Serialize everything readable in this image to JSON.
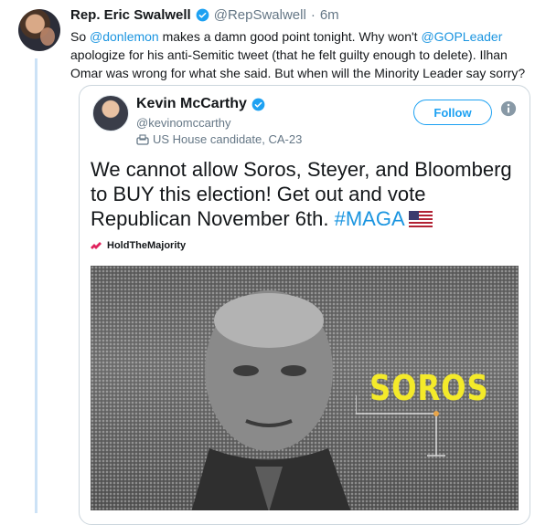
{
  "tweet": {
    "author_name": "Rep. Eric Swalwell",
    "author_handle": "@RepSwalwell",
    "separator": "·",
    "time": "6m",
    "text_part1": "So ",
    "mention1": "@donlemon",
    "text_part2": " makes a damn good point tonight. Why won't ",
    "mention2": "@GOPLeader",
    "text_part3": " apologize for his anti-Semitic tweet (that he felt guilty enough to delete). Ilhan Omar was wrong for what she said. But when will the Minority Leader say sorry?"
  },
  "quoted": {
    "author_name": "Kevin McCarthy",
    "author_handle": "@kevinomccarthy",
    "candidate_label": "US House candidate, CA-23",
    "follow_label": "Follow",
    "text_main": "We cannot allow Soros, Steyer, and Bloomberg to BUY this election! Get out and vote Republican November 6th. ",
    "hashtag": "#MAGA",
    "campaign_label": "HoldTheMajority",
    "image_caption": "SOROS"
  },
  "colors": {
    "accent": "#1da1f2",
    "link": "#1b95e0",
    "thread_line": "#cce2f6",
    "caption_yellow": "#f4ea2a"
  },
  "icons": [
    "verified-badge-icon",
    "ballot-box-icon",
    "info-icon",
    "us-flag-icon",
    "campaign-icon"
  ]
}
